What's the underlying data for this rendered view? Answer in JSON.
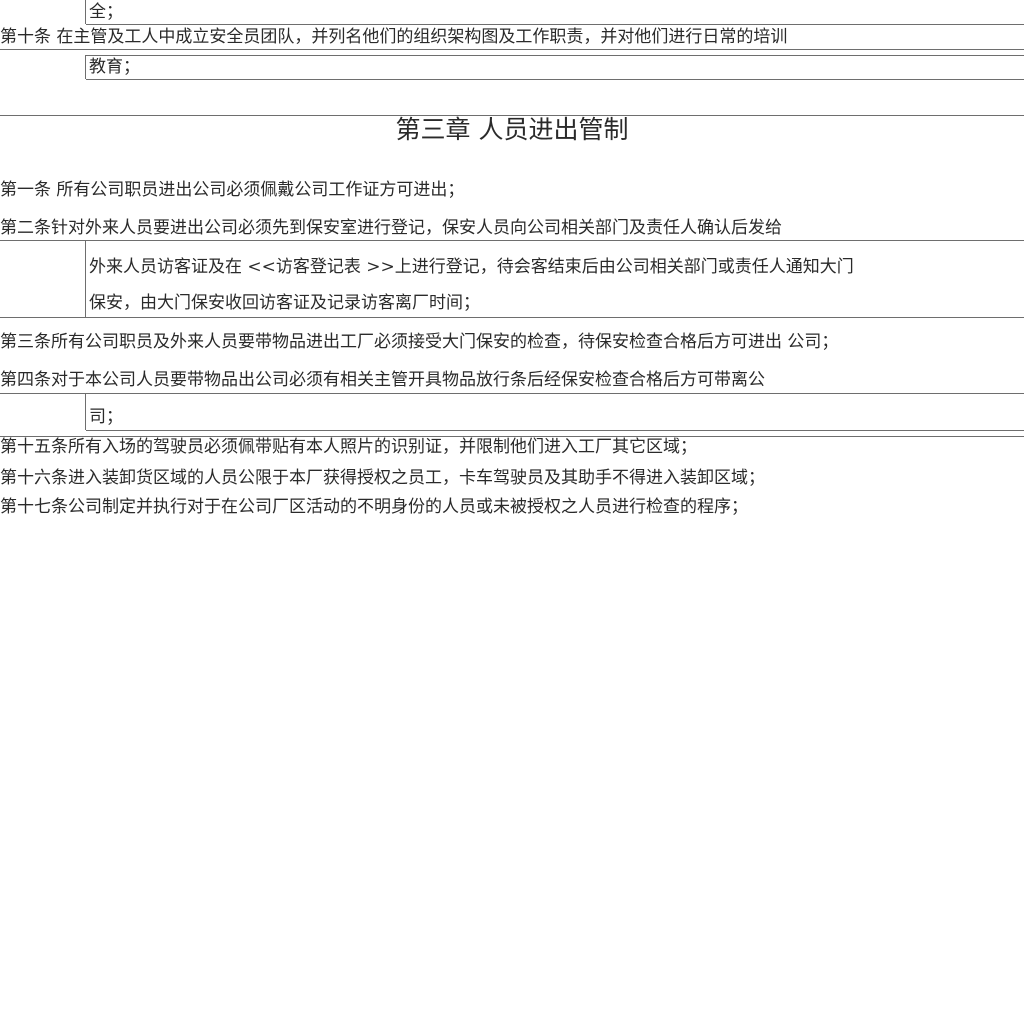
{
  "doc": {
    "top_fragment": "全；",
    "art10_line1": "第十条 在主管及工人中成立安全员团队，并列名他们的组织架构图及工作职责，并对他们进行日常的培训",
    "art10_line2": "教育；",
    "chapter_title": "第三章  人员进出管制",
    "art1": "第一条 所有公司职员进出公司必须佩戴公司工作证方可进出；",
    "art2_line1": "第二条针对外来人员要进出公司必须先到保安室进行登记，保安人员向公司相关部门及责任人确认后发给",
    "art2_line2": "外来人员访客证及在 <<访客登记表 >>上进行登记，待会客结束后由公司相关部门或责任人通知大门",
    "art2_line3": "保安，由大门保安收回访客证及记录访客离厂时间；",
    "art3": "第三条所有公司职员及外来人员要带物品进出工厂必须接受大门保安的检查，待保安检查合格后方可进出 公司；",
    "art4_line1": "第四条对于本公司人员要带物品出公司必须有相关主管开具物品放行条后经保安检查合格后方可带离公",
    "art4_line2": "司；",
    "art15": "第十五条所有入场的驾驶员必须佩带贴有本人照片的识别证，并限制他们进入工厂其它区域；",
    "art16": "第十六条进入装卸货区域的人员公限于本厂获得授权之员工，卡车驾驶员及其助手不得进入装卸区域；",
    "art17": "第十七条公司制定并执行对于在公司厂区活动的不明身份的人员或未被授权之人员进行检查的程序；"
  }
}
